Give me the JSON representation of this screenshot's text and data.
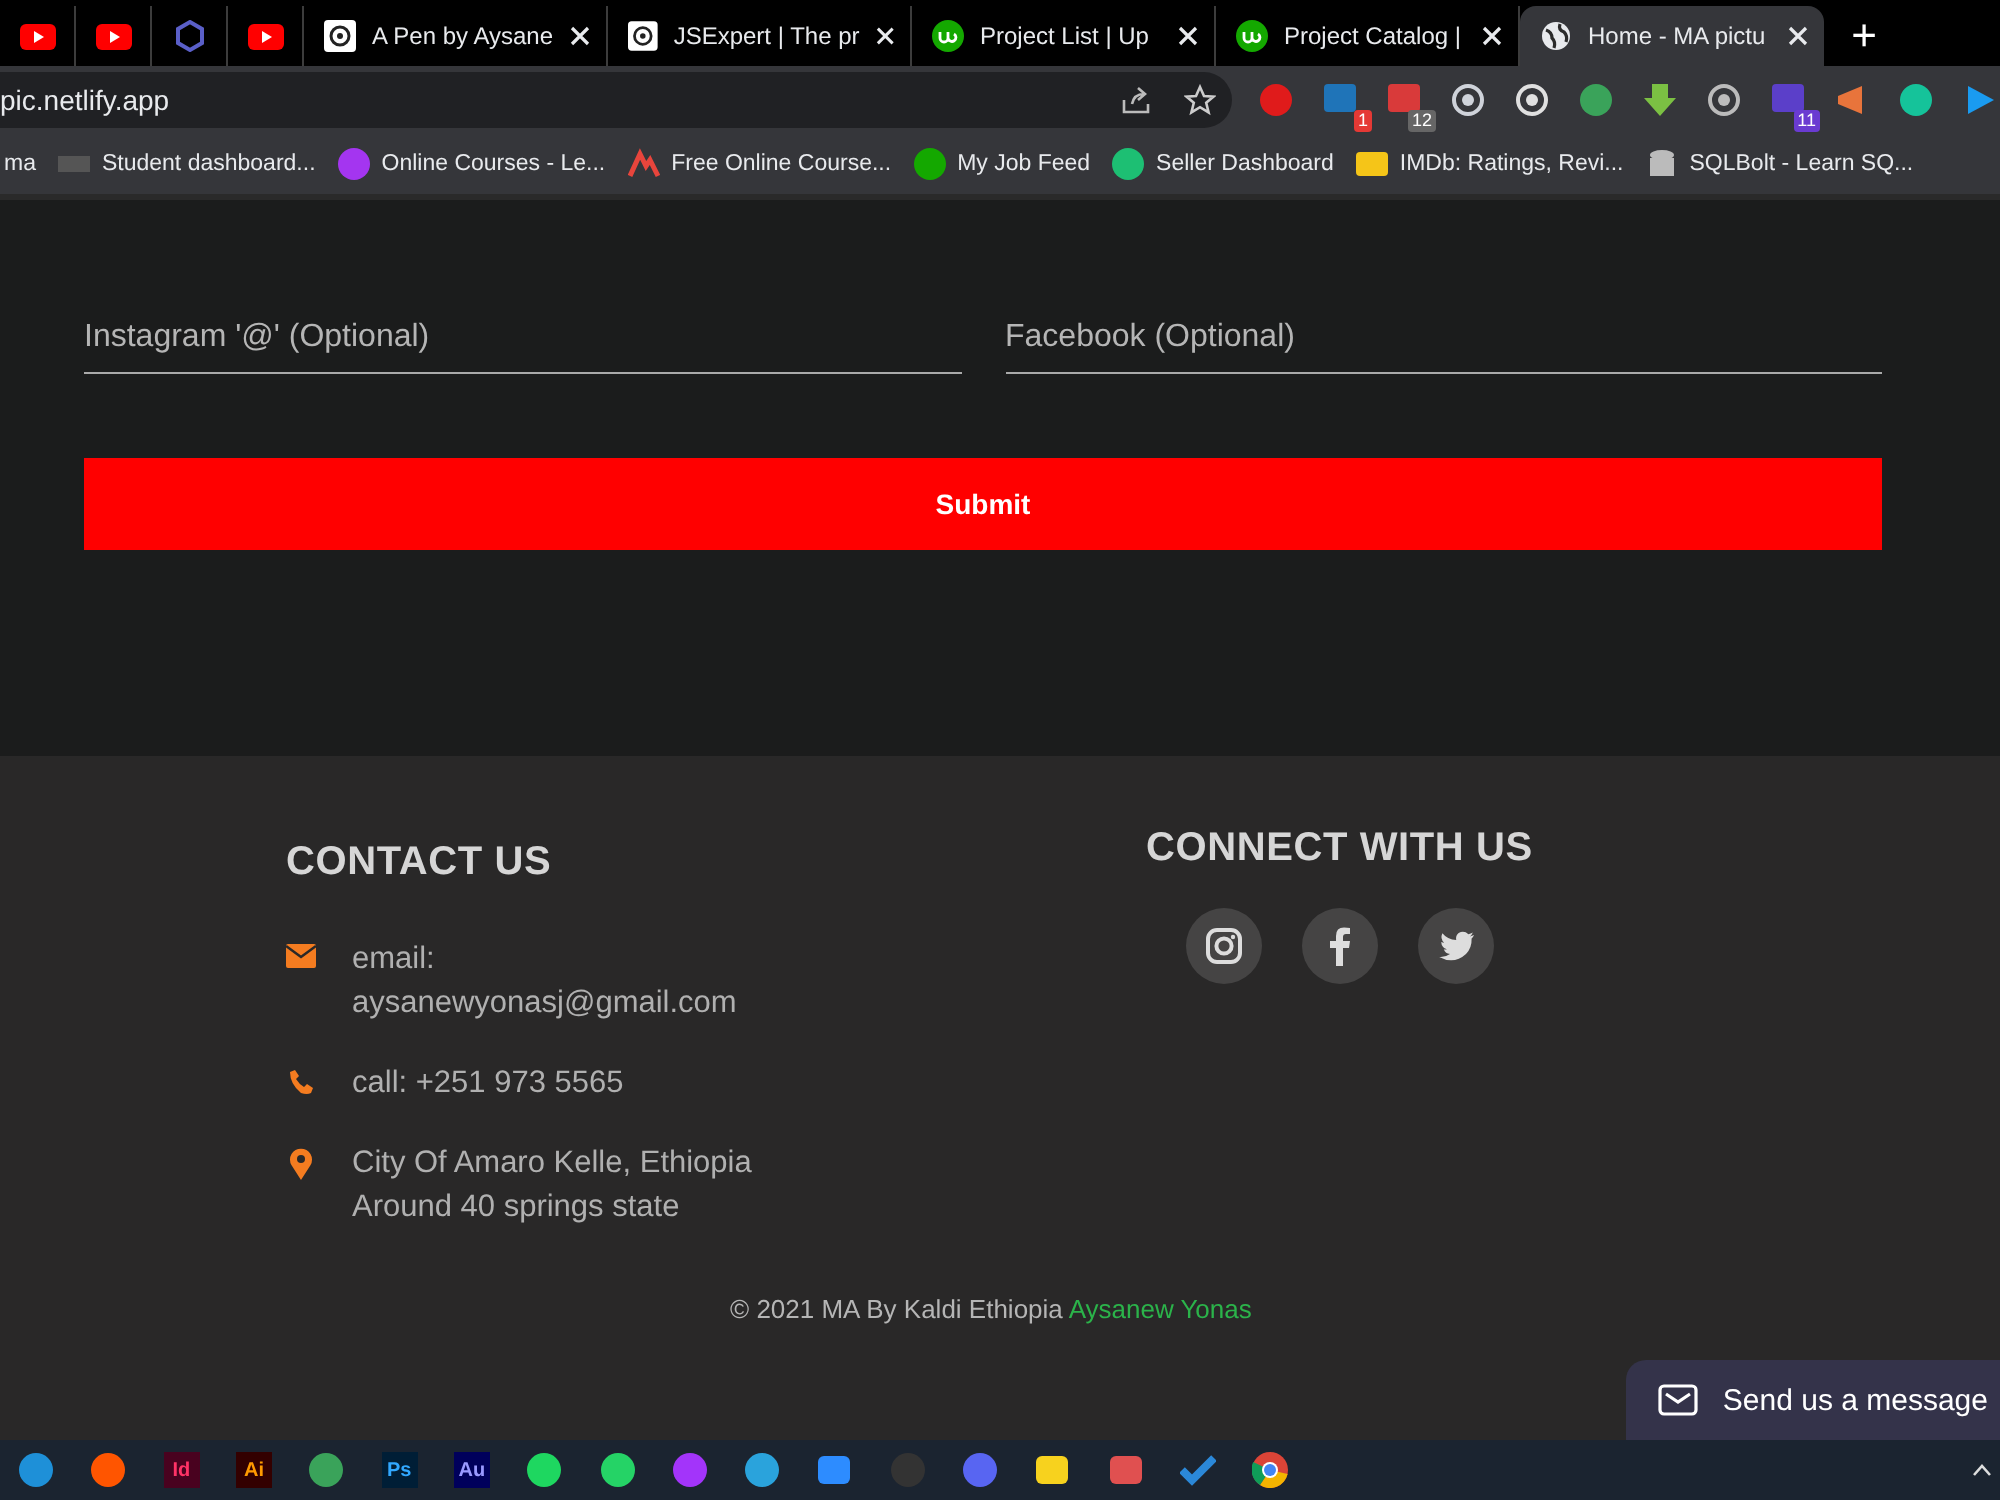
{
  "browser": {
    "tabs": [
      {
        "kind": "pinned",
        "selected": false
      },
      {
        "kind": "pinned",
        "selected": false
      },
      {
        "kind": "pinned",
        "selected": false
      },
      {
        "kind": "pinned",
        "selected": false
      },
      {
        "kind": "titled",
        "title": "A Pen by Aysane",
        "selected": false
      },
      {
        "kind": "titled",
        "title": "JSExpert | The pr",
        "selected": false
      },
      {
        "kind": "titled",
        "title": "Project List | Up",
        "selected": false
      },
      {
        "kind": "titled",
        "title": "Project Catalog |",
        "selected": false
      },
      {
        "kind": "titled",
        "title": "Home - MA pictu",
        "selected": true
      }
    ],
    "new_tab": "+",
    "address": "pic.netlify.app",
    "extension_badges": [
      "1",
      "12",
      "11"
    ],
    "bookmarks": [
      {
        "label": "ma"
      },
      {
        "label": "Student dashboard..."
      },
      {
        "label": "Online Courses - Le..."
      },
      {
        "label": "Free Online Course..."
      },
      {
        "label": "My Job Feed"
      },
      {
        "label": "Seller Dashboard"
      },
      {
        "label": "IMDb: Ratings, Revi..."
      },
      {
        "label": "SQLBolt - Learn SQ..."
      }
    ]
  },
  "form": {
    "fields": [
      {
        "placeholder": "Instagram '@' (Optional)"
      },
      {
        "placeholder": "Facebook (Optional)"
      }
    ],
    "submit": "Submit"
  },
  "footer": {
    "contact_title": "CONTACT US",
    "contacts": [
      {
        "kind": "email",
        "text": "email: aysanewyonasj@gmail.com"
      },
      {
        "kind": "phone",
        "text": "call: +251 973 5565"
      },
      {
        "kind": "location",
        "text": "City Of Amaro Kelle, Ethiopia Around 40 springs state"
      }
    ],
    "connect_title": "CONNECT WITH US",
    "socials": [
      {
        "kind": "instagram"
      },
      {
        "kind": "facebook"
      },
      {
        "kind": "twitter"
      }
    ],
    "copyright": "© 2021 MA By Kaldi Ethiopia",
    "author": "Aysanew Yonas"
  },
  "chat_button": "Send us a message",
  "taskbar": {
    "apps": [
      {
        "selected": false
      },
      {
        "selected": false
      },
      {
        "label": "Id",
        "selected": false
      },
      {
        "label": "Ai",
        "selected": false
      },
      {
        "selected": false
      },
      {
        "label": "Ps",
        "selected": false
      },
      {
        "label": "Au",
        "selected": false
      },
      {
        "selected": false
      },
      {
        "selected": false
      },
      {
        "selected": false
      },
      {
        "selected": false
      },
      {
        "selected": false
      },
      {
        "selected": false
      },
      {
        "selected": false
      },
      {
        "selected": false
      },
      {
        "selected": false
      },
      {
        "selected": false
      },
      {
        "selected": false
      }
    ]
  }
}
